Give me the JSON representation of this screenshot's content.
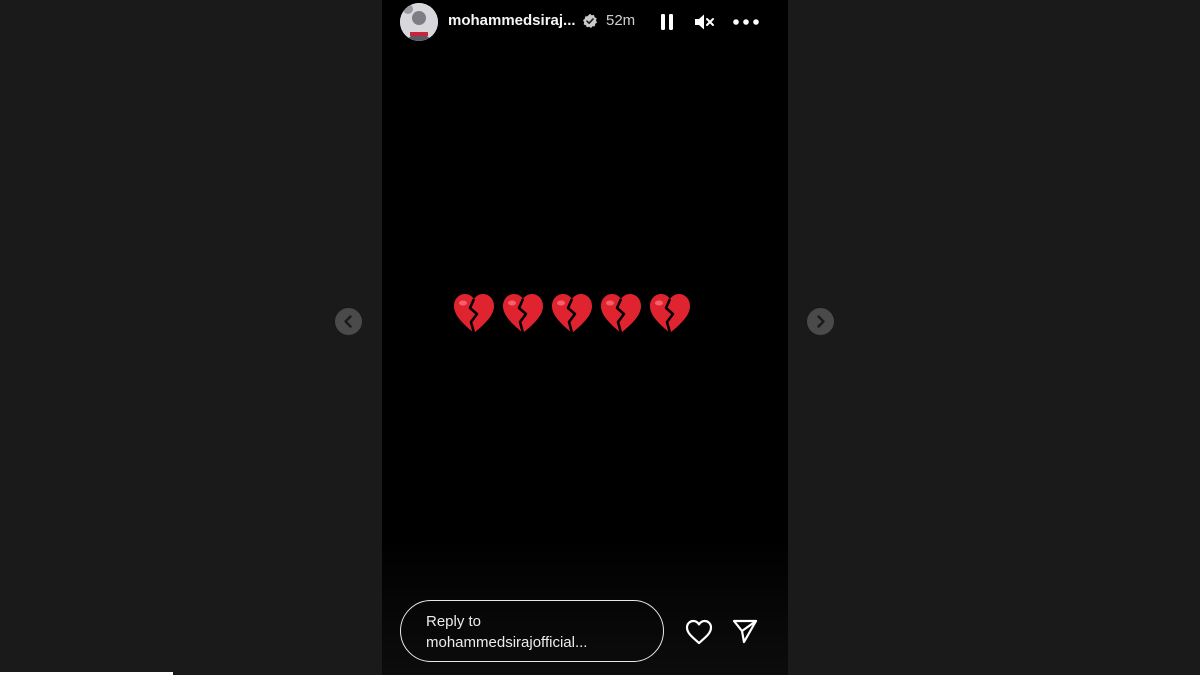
{
  "story": {
    "username": "mohammedsiraj...",
    "time": "52m",
    "content": [
      "💔",
      "💔",
      "💔",
      "💔",
      "💔"
    ]
  },
  "icons": {
    "verified": "verified-badge-icon",
    "pause": "pause-icon",
    "mute": "muted-speaker-icon",
    "more": "more-options-icon",
    "prev": "chevron-left-icon",
    "next": "chevron-right-icon",
    "like": "heart-icon",
    "share": "paper-plane-icon"
  },
  "reply": {
    "line1": "Reply to",
    "line2": "mohammedsirajofficial..."
  },
  "colors": {
    "page_bg": "#1a1a1a",
    "story_bg": "#000000",
    "heart_red": "#e0242f"
  }
}
